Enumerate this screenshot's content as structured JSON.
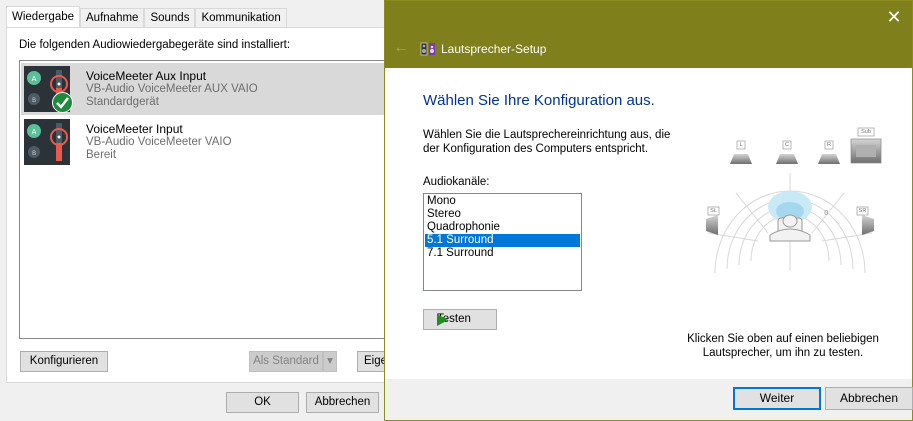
{
  "sound_dialog": {
    "tabs": [
      "Wiedergabe",
      "Aufnahme",
      "Sounds",
      "Kommunikation"
    ],
    "instruction": "Die folgenden Audiowiedergabegeräte sind installiert:",
    "devices": [
      {
        "name": "VoiceMeeter Aux Input",
        "driver": "VB-Audio VoiceMeeter AUX VAIO",
        "status": "Standardgerät",
        "selected": true,
        "default": true
      },
      {
        "name": "VoiceMeeter Input",
        "driver": "VB-Audio VoiceMeeter VAIO",
        "status": "Bereit",
        "selected": false,
        "default": false
      }
    ],
    "buttons": {
      "configure": "Konfigurieren",
      "set_default": "Als Standard",
      "properties": "Eige",
      "ok": "OK",
      "cancel": "Abbrechen"
    }
  },
  "speaker_setup": {
    "window_title": "Lautsprecher-Setup",
    "heading": "Wählen Sie Ihre Konfiguration aus.",
    "description": "Wählen Sie die Lautsprechereinrichtung aus, die der Konfiguration des Computers entspricht.",
    "channels_label": "Audiokanäle:",
    "channels": [
      "Mono",
      "Stereo",
      "Quadrophonie",
      "5.1 Surround",
      "7.1 Surround"
    ],
    "selected_channel": "5.1 Surround",
    "test_button": "Testen",
    "hint": "Klicken Sie oben auf einen beliebigen Lautsprecher, um ihn zu testen.",
    "speaker_labels": {
      "left": "L",
      "center": "C",
      "right": "R",
      "sub": "Sub",
      "surround_left": "SL",
      "surround_right": "SR"
    },
    "next_button": "Weiter",
    "cancel_button": "Abbrechen",
    "colors": {
      "titlebar": "#7f7f1c",
      "heading": "#003399",
      "selection": "#0078d7"
    }
  }
}
